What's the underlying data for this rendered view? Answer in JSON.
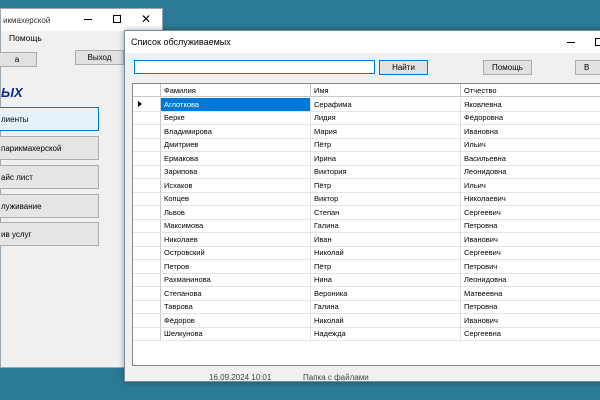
{
  "back_window": {
    "title": "икмахерской",
    "menu_help": "Помощь",
    "btn_left": "а",
    "btn_exit": "Выход",
    "heading": "ЫХ",
    "menu_buttons": [
      {
        "label": "лиенты"
      },
      {
        "label": "парикмахерской"
      },
      {
        "label": "айс лист"
      },
      {
        "label": "луживание"
      },
      {
        "label": "ив услуг"
      }
    ]
  },
  "front_window": {
    "title": "Список обслуживаемых",
    "search": {
      "value": "",
      "placeholder": ""
    },
    "find_label": "Найти",
    "help_label": "Помощь",
    "exit_label": "В",
    "columns": [
      "Фамилия",
      "Имя",
      "Отчество"
    ],
    "rows": [
      [
        "Аглоткова",
        "Серафима",
        "Яковлевна"
      ],
      [
        "Берке",
        "Лидия",
        "Фёдоровна"
      ],
      [
        "Владимирова",
        "Мария",
        "Ивановна"
      ],
      [
        "Дмитриев",
        "Пётр",
        "Ильич"
      ],
      [
        "Ермакова",
        "Ирина",
        "Васильевна"
      ],
      [
        "Зарипова",
        "Виктория",
        "Леонидовна"
      ],
      [
        "Исхаков",
        "Пётр",
        "Ильич"
      ],
      [
        "Копцев",
        "Виктор",
        "Николаевич"
      ],
      [
        "Львов",
        "Степан",
        "Сергеевич"
      ],
      [
        "Максимова",
        "Галина",
        "Петровна"
      ],
      [
        "Николаев",
        "Иван",
        "Иванович"
      ],
      [
        "Островский",
        "Николай",
        "Сергеевич"
      ],
      [
        "Петров",
        "Пётр",
        "Петрович"
      ],
      [
        "Рахманинова",
        "Нина",
        "Леонидовна"
      ],
      [
        "Степанова",
        "Вероника",
        "Матвеевна"
      ],
      [
        "Таврова",
        "Галина",
        "Петровна"
      ],
      [
        "Фёдоров",
        "Николай",
        "Иванович"
      ],
      [
        "Шелкунова",
        "Надежда",
        "Сергеевна"
      ]
    ],
    "selected_row": 0
  },
  "status_bar": {
    "datetime": "16.09.2024 10:01",
    "folder": "Папка с файлами"
  }
}
